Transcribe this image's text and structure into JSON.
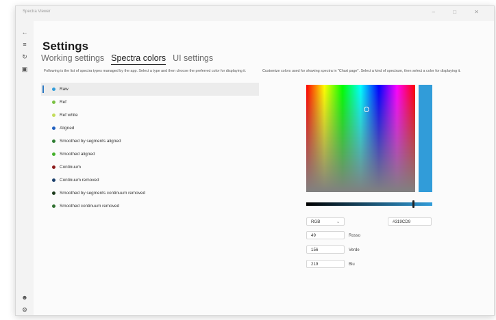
{
  "window": {
    "app_title": "Spectra Viewer",
    "controls": "– □ ✕"
  },
  "navrail": {
    "icons": [
      "back-icon",
      "menu-icon",
      "data-icon",
      "chart-icon",
      "user-icon",
      "settings-icon"
    ]
  },
  "page": {
    "title": "Settings"
  },
  "tabs": [
    {
      "label": "Working settings",
      "active": false
    },
    {
      "label": "Spectra colors",
      "active": true
    },
    {
      "label": "UI settings",
      "active": false
    }
  ],
  "left_desc": "Following is the list of spectra types managed by the app. Select a type and then choose the preferred color for displaying it.",
  "right_desc": "Customize colors used for showing spectra in \"Chart page\". Select a kind of spectrum, then select a color for displaying it.",
  "spectra_types": [
    {
      "label": "Raw",
      "color": "#319cd9",
      "selected": true
    },
    {
      "label": "Ref",
      "color": "#7ac143",
      "selected": false
    },
    {
      "label": "Ref white",
      "color": "#c3dc5a",
      "selected": false
    },
    {
      "label": "Aligned",
      "color": "#1f5fbf",
      "selected": false
    },
    {
      "label": "Smoothed by segments aligned",
      "color": "#2e7d32",
      "selected": false
    },
    {
      "label": "Smoothed aligned",
      "color": "#43b02a",
      "selected": false
    },
    {
      "label": "Continuum",
      "color": "#8b1a1a",
      "selected": false
    },
    {
      "label": "Continuum removed",
      "color": "#1b3f6b",
      "selected": false
    },
    {
      "label": "Smoothed by segments continuum removed",
      "color": "#1b3a1b",
      "selected": false
    },
    {
      "label": "Smoothed continuum removed",
      "color": "#2f6f2f",
      "selected": false
    }
  ],
  "color_picker": {
    "selected_color": "#319cd9",
    "mode": "RGB",
    "hex": "#319CD9",
    "channels": [
      {
        "value": "49",
        "label": "Rosso"
      },
      {
        "value": "156",
        "label": "Verde"
      },
      {
        "value": "219",
        "label": "Blu"
      }
    ]
  }
}
